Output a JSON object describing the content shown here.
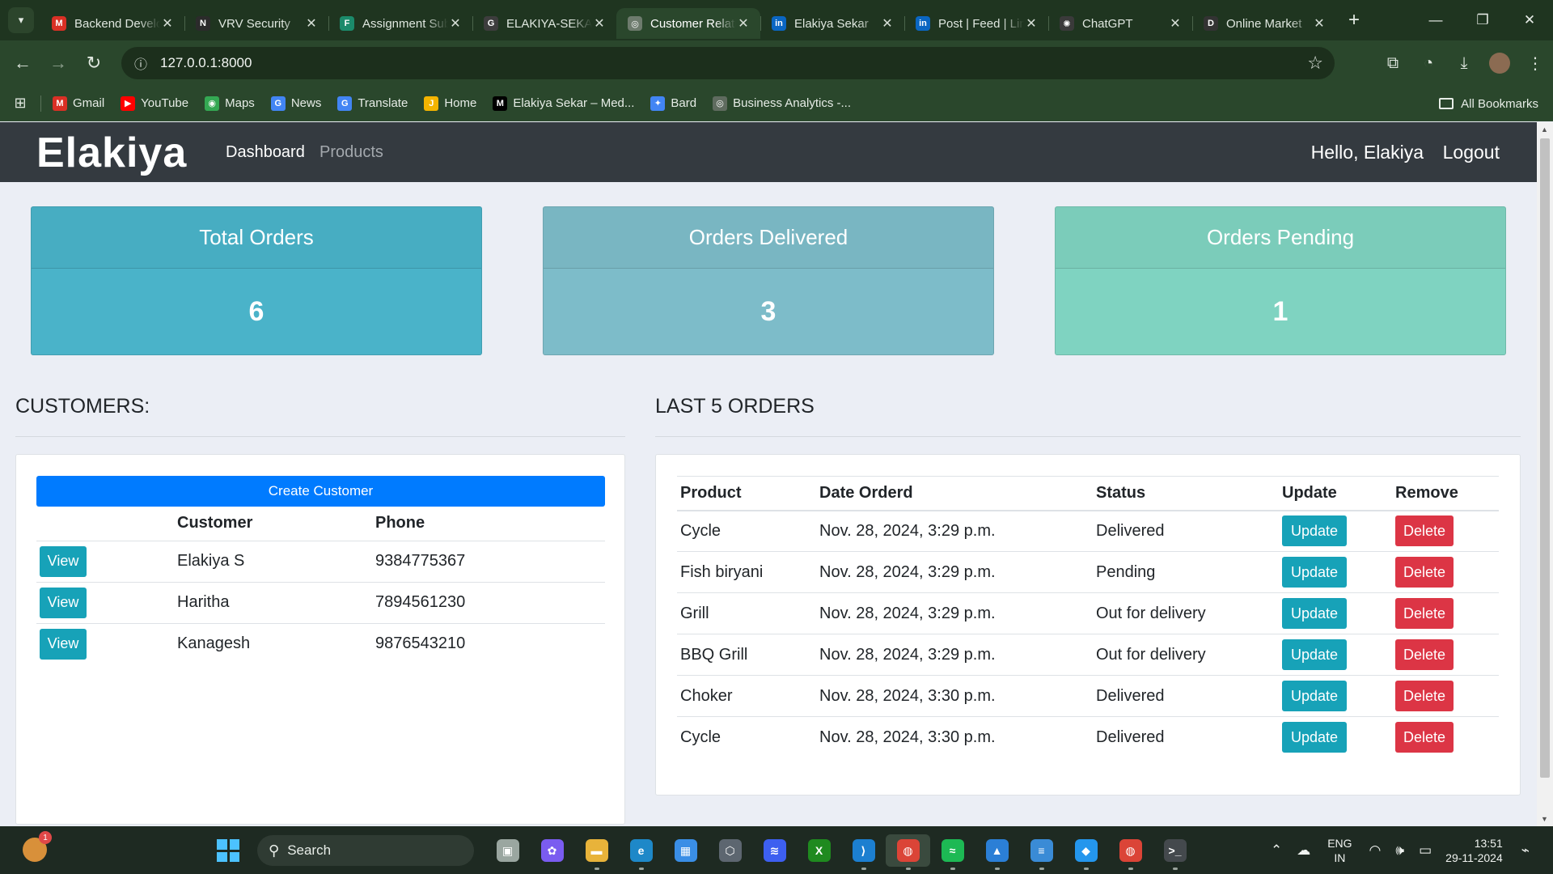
{
  "browser": {
    "tabs": [
      {
        "title": "Backend Developer",
        "favicon": "gmail-icon",
        "color": "#d93025",
        "glyph": "M",
        "active": false
      },
      {
        "title": "VRV Security",
        "favicon": "notion-icon",
        "color": "#2b2b2b",
        "glyph": "N",
        "active": false
      },
      {
        "title": "Assignment Submission",
        "favicon": "forms-icon",
        "color": "#1b8a6b",
        "glyph": "F",
        "active": false
      },
      {
        "title": "ELAKIYA-SEKAR",
        "favicon": "github-icon",
        "color": "#3d3d3d",
        "glyph": "G",
        "active": false
      },
      {
        "title": "Customer Relationship",
        "favicon": "globe-icon",
        "color": "#6d7b6d",
        "glyph": "◎",
        "active": true
      },
      {
        "title": "Elakiya Sekar",
        "favicon": "linkedin-icon",
        "color": "#0a66c2",
        "glyph": "in",
        "active": false
      },
      {
        "title": "Post | Feed | LinkedIn",
        "favicon": "linkedin-icon",
        "color": "#0a66c2",
        "glyph": "in",
        "active": false
      },
      {
        "title": "ChatGPT",
        "favicon": "openai-icon",
        "color": "#3a3a3a",
        "glyph": "✺",
        "active": false
      },
      {
        "title": "Online Market",
        "favicon": "d-icon",
        "color": "#333333",
        "glyph": "D",
        "active": false
      }
    ],
    "url": "127.0.0.1:8000",
    "bookmarks": [
      {
        "label": "Gmail",
        "color": "#d93025",
        "glyph": "M"
      },
      {
        "label": "YouTube",
        "color": "#ff0000",
        "glyph": "▶"
      },
      {
        "label": "Maps",
        "color": "#34a853",
        "glyph": "◉"
      },
      {
        "label": "News",
        "color": "#4285f4",
        "glyph": "G"
      },
      {
        "label": "Translate",
        "color": "#4285f4",
        "glyph": "G"
      },
      {
        "label": "Home",
        "color": "#f4b400",
        "glyph": "J"
      },
      {
        "label": "Elakiya Sekar – Med...",
        "color": "#000000",
        "glyph": "M"
      },
      {
        "label": "Bard",
        "color": "#4285f4",
        "glyph": "✦"
      },
      {
        "label": "Business Analytics -...",
        "color": "#5f6b5f",
        "glyph": "◎"
      }
    ],
    "all_bookmarks": "All Bookmarks"
  },
  "site": {
    "brand": "Elakiya",
    "nav": {
      "dashboard": "Dashboard",
      "products": "Products",
      "hello": "Hello, Elakiya",
      "logout": "Logout"
    },
    "stats": [
      {
        "label": "Total Orders",
        "value": "6",
        "color": "#4ab3c9"
      },
      {
        "label": "Orders Delivered",
        "value": "3",
        "color": "#7dbcc9"
      },
      {
        "label": "Orders Pending",
        "value": "1",
        "color": "#7fd3c1"
      }
    ],
    "customers_title": "CUSTOMERS:",
    "orders_title": "LAST 5 ORDERS",
    "create_customer": "Create Customer",
    "customer_headers": [
      "",
      "Customer",
      "Phone"
    ],
    "view_label": "View",
    "customers": [
      {
        "name": "Elakiya S",
        "phone": "9384775367"
      },
      {
        "name": "Haritha",
        "phone": "7894561230"
      },
      {
        "name": "Kanagesh",
        "phone": "9876543210"
      }
    ],
    "order_headers": [
      "Product",
      "Date Orderd",
      "Status",
      "Update",
      "Remove"
    ],
    "update_label": "Update",
    "delete_label": "Delete",
    "orders": [
      {
        "product": "Cycle",
        "date": "Nov. 28, 2024, 3:29 p.m.",
        "status": "Delivered"
      },
      {
        "product": "Fish biryani",
        "date": "Nov. 28, 2024, 3:29 p.m.",
        "status": "Pending"
      },
      {
        "product": "Grill",
        "date": "Nov. 28, 2024, 3:29 p.m.",
        "status": "Out for delivery"
      },
      {
        "product": "BBQ Grill",
        "date": "Nov. 28, 2024, 3:29 p.m.",
        "status": "Out for delivery"
      },
      {
        "product": "Choker",
        "date": "Nov. 28, 2024, 3:30 p.m.",
        "status": "Delivered"
      },
      {
        "product": "Cycle",
        "date": "Nov. 28, 2024, 3:30 p.m.",
        "status": "Delivered"
      }
    ]
  },
  "taskbar": {
    "weather_badge": "1",
    "search_label": "Search",
    "apps": [
      {
        "name": "task-view-icon",
        "color": "#9aa6a0",
        "glyph": "▣"
      },
      {
        "name": "copilot-icon",
        "color": "#7a5cf0",
        "glyph": "✿"
      },
      {
        "name": "file-explorer-icon",
        "color": "#e8b33a",
        "glyph": "▬"
      },
      {
        "name": "edge-icon",
        "color": "#1e88c8",
        "glyph": "e"
      },
      {
        "name": "microsoft-store-icon",
        "color": "#3a8ee6",
        "glyph": "▦"
      },
      {
        "name": "unity-icon",
        "color": "#5d6670",
        "glyph": "⬡"
      },
      {
        "name": "powerautomate-icon",
        "color": "#3d5ff0",
        "glyph": "≋"
      },
      {
        "name": "xbox-icon",
        "color": "#1f8a1f",
        "glyph": "X"
      },
      {
        "name": "vscode-icon",
        "color": "#1c7fd0",
        "glyph": "⟩"
      },
      {
        "name": "chrome-icon",
        "color": "#db4437",
        "glyph": "◍"
      },
      {
        "name": "spotify-icon",
        "color": "#1db954",
        "glyph": "≈"
      },
      {
        "name": "photos-icon",
        "color": "#2b7fd6",
        "glyph": "▲"
      },
      {
        "name": "notepad-icon",
        "color": "#3a8bd6",
        "glyph": "≡"
      },
      {
        "name": "docker-icon",
        "color": "#2496ed",
        "glyph": "◆"
      },
      {
        "name": "chrome-profile-icon",
        "color": "#db4437",
        "glyph": "◍"
      },
      {
        "name": "terminal-icon",
        "color": "#44494d",
        "glyph": ">_"
      }
    ],
    "lang_top": "ENG",
    "lang_bottom": "IN",
    "time": "13:51",
    "date": "29-11-2024"
  }
}
